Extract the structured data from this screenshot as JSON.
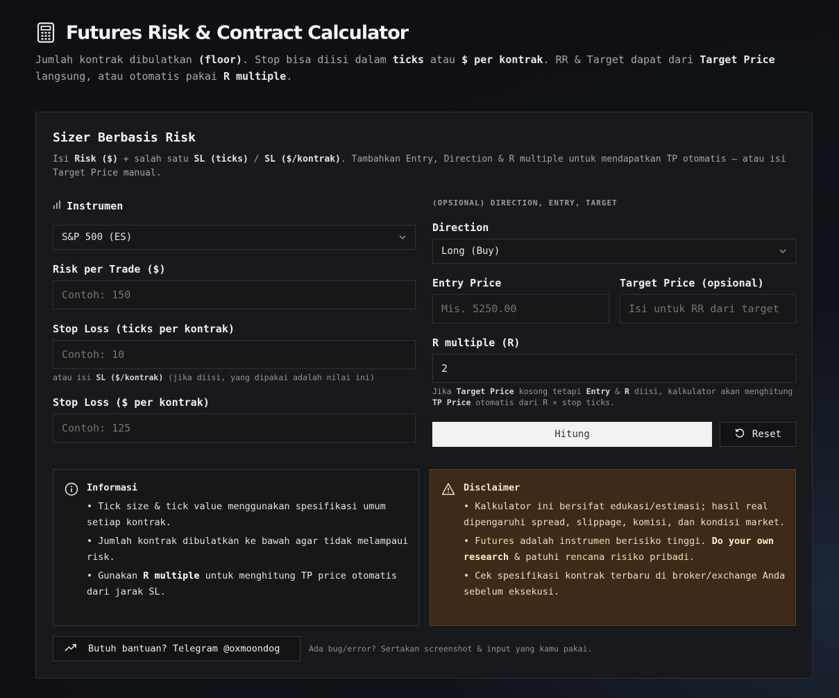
{
  "header": {
    "title": "Futures Risk & Contract Calculator",
    "subtitle": {
      "p1": "Jumlah kontrak dibulatkan ",
      "b1": "(floor)",
      "p2": ". Stop bisa diisi dalam ",
      "b2": "ticks",
      "p3": " atau ",
      "b3": "$ per kontrak",
      "p4": ". RR & Target dapat dari ",
      "b4": "Target Price",
      "p5": " langsung, atau otomatis pakai ",
      "b5": "R multiple",
      "p6": "."
    },
    "icon": "calculator-icon"
  },
  "card": {
    "title": "Sizer Berbasis Risk",
    "desc": {
      "p1": "Isi ",
      "b1": "Risk ($)",
      "p2": " + salah satu ",
      "b2": "SL (ticks)",
      "p3": " / ",
      "b3": "SL ($/kontrak)",
      "p4": ". Tambahkan Entry, Direction & R multiple untuk mendapatkan TP otomatis — atau isi Target Price manual."
    }
  },
  "left": {
    "instrument_label": "Instrumen",
    "instrument_value": "S&P 500 (ES)",
    "risk_label": "Risk per Trade ($)",
    "risk_placeholder": "Contoh: 150",
    "sl_ticks_label": "Stop Loss (ticks per kontrak)",
    "sl_ticks_placeholder": "Contoh: 10",
    "sl_hint": {
      "p1": "atau isi ",
      "b1": "SL ($/kontrak)",
      "p2": " (jika diisi, yang dipakai adalah nilai ini)"
    },
    "sl_dollar_label": "Stop Loss ($ per kontrak)",
    "sl_dollar_placeholder": "Contoh: 125"
  },
  "right": {
    "caption": "(OPSIONAL) DIRECTION, ENTRY, TARGET",
    "direction_label": "Direction",
    "direction_value": "Long (Buy)",
    "entry_label": "Entry Price",
    "entry_placeholder": "Mis. 5250.00",
    "target_label": "Target Price (opsional)",
    "target_placeholder": "Isi untuk RR dari target",
    "r_label": "R multiple (R)",
    "r_value": "2",
    "r_hint": {
      "p1": "Jika ",
      "b1": "Target Price",
      "p2": " kosong tetapi ",
      "b2": "Entry",
      "p3": " & ",
      "b3": "R",
      "p4": " diisi, kalkulator akan menghitung ",
      "b4": "TP Price",
      "p5": " otomatis dari R × stop ticks."
    },
    "hitung_label": "Hitung",
    "reset_label": "Reset"
  },
  "info": {
    "title": "Informasi",
    "item1": "• Tick size & tick value menggunakan spesifikasi umum setiap kontrak.",
    "item2": "• Jumlah kontrak dibulatkan ke bawah agar tidak melampaui risk.",
    "item3": {
      "p1": "• Gunakan ",
      "b1": "R multiple",
      "p2": " untuk menghitung TP price otomatis dari jarak SL."
    }
  },
  "disclaimer": {
    "title": "Disclaimer",
    "item1": "• Kalkulator ini bersifat edukasi/estimasi; hasil real dipengaruhi spread, slippage, komisi, dan kondisi market.",
    "item2": {
      "p1": "• Futures adalah instrumen berisiko tinggi. ",
      "b1": "Do your own research",
      "p2": " & patuhi rencana risiko pribadi."
    },
    "item3": "• Cek spesifikasi kontrak terbaru di broker/exchange Anda sebelum eksekusi."
  },
  "footer": {
    "help_label": "Butuh bantuan? Telegram @oxmoondog",
    "note": "Ada bug/error? Sertakan screenshot & input yang kamu pakai."
  },
  "colors": {
    "background": "#0d0f13",
    "card": "#18191c",
    "warning_bg": "#3d2a19",
    "primary_button": "#f2f2f2"
  }
}
